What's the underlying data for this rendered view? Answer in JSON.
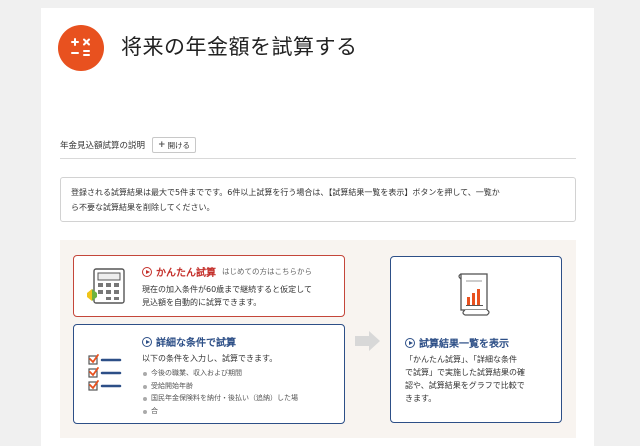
{
  "page": {
    "title": "将来の年金額を試算する",
    "title_icon": "calculator-icon",
    "accent_color": "#e8511f"
  },
  "explanation": {
    "label": "年金見込額試算の説明",
    "open_button": "開ける",
    "open_button_icon": "plus-icon"
  },
  "notice": {
    "line1": "登録される試算結果は最大で5件までです。6件以上試算を行う場合は、【試算結果一覧を表示】ボタンを押して、一覧か",
    "line2": "ら不要な試算結果を削除してください。"
  },
  "simple_calc": {
    "title": "かんたん試算",
    "subtitle": "はじめての方はこちらから",
    "desc_line1": "現在の加入条件が60歳まで継続すると仮定して",
    "desc_line2": "見込額を自動的に試算できます。",
    "icon": "calculator-with-leaf-icon",
    "border_color": "#c4463a"
  },
  "detail_calc": {
    "title": "詳細な条件で試算",
    "desc": "以下の条件を入力し、試算できます。",
    "bullets": [
      "今後の職業、収入および期間",
      "受給開始年齢",
      "国民年金保険料を納付・後払い（追納）した場",
      "合"
    ],
    "icon": "checklist-icon",
    "border_color": "#2d4f87"
  },
  "result_list": {
    "title": "試算結果一覧を表示",
    "desc_line1": "「かんたん試算」、「詳細な条件",
    "desc_line2": "で試算」で実施した試算結果の確",
    "desc_line3": "認や、試算結果をグラフで比較で",
    "desc_line4": "きます。",
    "icon": "report-chart-icon"
  }
}
